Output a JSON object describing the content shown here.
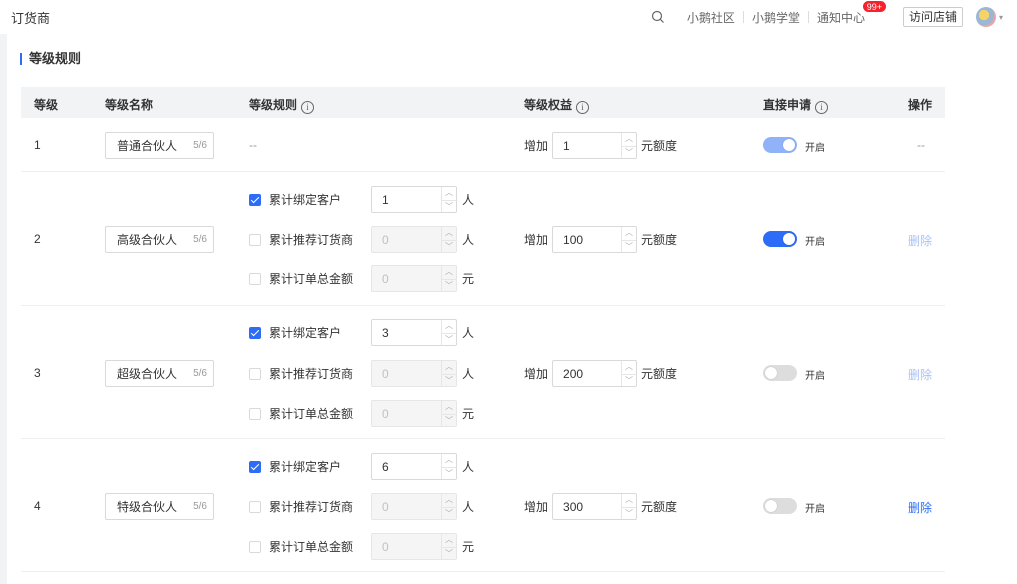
{
  "app": {
    "title": "订货商"
  },
  "topnav": {
    "links": [
      "小鹅社区",
      "小鹅学堂"
    ],
    "notice": "通知中心",
    "notice_badge": "99+",
    "visit_store": "访问店铺"
  },
  "section": {
    "title": "等级规则"
  },
  "table": {
    "headers": {
      "level": "等级",
      "name": "等级名称",
      "rule": "等级规则",
      "benefit": "等级权益",
      "direct": "直接申请",
      "action": "操作"
    },
    "info_glyph": "i",
    "rows": [
      {
        "level": "1",
        "name": "普通合伙人",
        "count": "5/6",
        "rule_text": "--",
        "benefit_prefix": "增加",
        "benefit_value": "1",
        "benefit_unit": "元额度",
        "switch_label": "开启",
        "action": "--"
      },
      {
        "level": "2",
        "name": "高级合伙人",
        "count": "5/6",
        "rules": [
          {
            "label": "累计绑定客户",
            "value": "1",
            "unit": "人",
            "checked": true
          },
          {
            "label": "累计推荐订货商",
            "value": "0",
            "unit": "人",
            "checked": false
          },
          {
            "label": "累计订单总金额",
            "value": "0",
            "unit": "元",
            "checked": false
          }
        ],
        "benefit_prefix": "增加",
        "benefit_value": "100",
        "benefit_unit": "元额度",
        "switch_label": "开启",
        "action": "删除"
      },
      {
        "level": "3",
        "name": "超级合伙人",
        "count": "5/6",
        "rules": [
          {
            "label": "累计绑定客户",
            "value": "3",
            "unit": "人",
            "checked": true
          },
          {
            "label": "累计推荐订货商",
            "value": "0",
            "unit": "人",
            "checked": false
          },
          {
            "label": "累计订单总金额",
            "value": "0",
            "unit": "元",
            "checked": false
          }
        ],
        "benefit_prefix": "增加",
        "benefit_value": "200",
        "benefit_unit": "元额度",
        "switch_label": "开启",
        "action": "删除"
      },
      {
        "level": "4",
        "name": "特级合伙人",
        "count": "5/6",
        "rules": [
          {
            "label": "累计绑定客户",
            "value": "6",
            "unit": "人",
            "checked": true
          },
          {
            "label": "累计推荐订货商",
            "value": "0",
            "unit": "人",
            "checked": false
          },
          {
            "label": "累计订单总金额",
            "value": "0",
            "unit": "元",
            "checked": false
          }
        ],
        "benefit_prefix": "增加",
        "benefit_value": "300",
        "benefit_unit": "元额度",
        "switch_label": "开启",
        "action": "删除"
      }
    ]
  },
  "colors": {
    "accent": "#2d6cf6",
    "header_bg": "#f2f3f5"
  }
}
